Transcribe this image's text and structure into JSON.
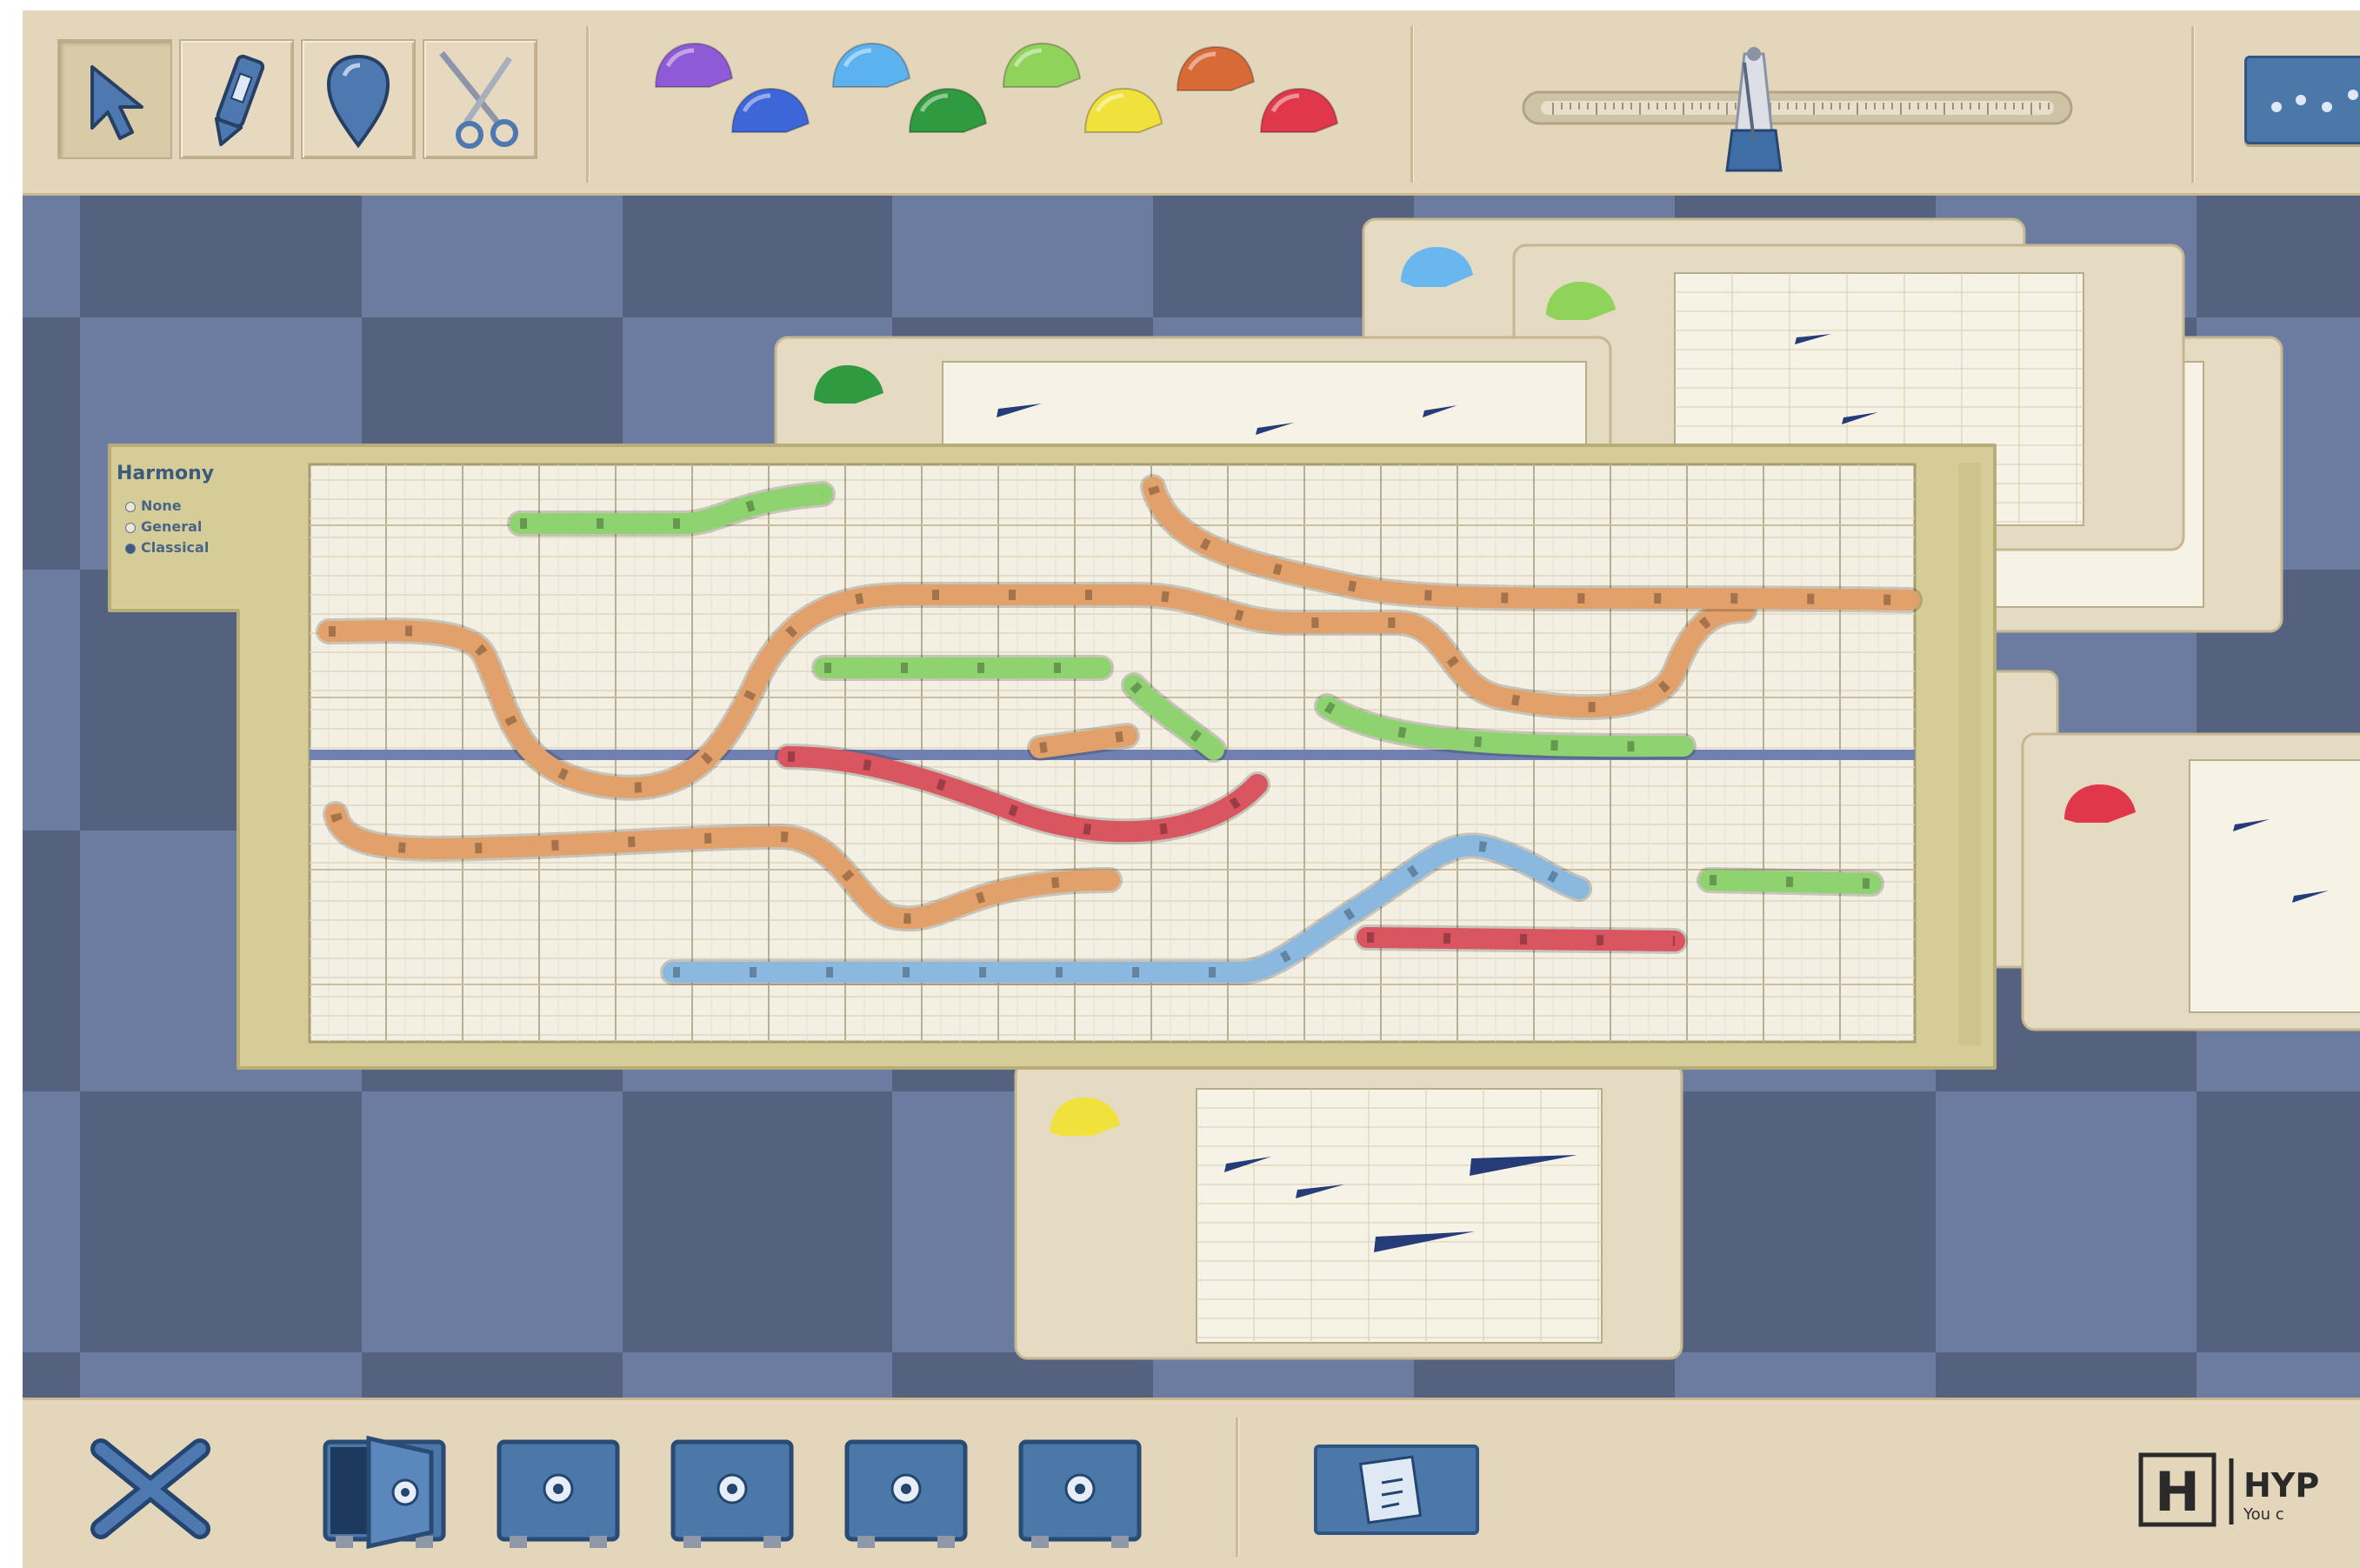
{
  "toolbar": {
    "tools": [
      {
        "name": "pointer",
        "icon": "arrow-cursor-icon",
        "active": true
      },
      {
        "name": "pencil",
        "icon": "pencil-icon",
        "active": false
      },
      {
        "name": "eraser",
        "icon": "eraser-drop-icon",
        "active": false
      },
      {
        "name": "scissors",
        "icon": "scissors-icon",
        "active": false
      }
    ],
    "instrument_colors": [
      "#8f5ad6",
      "#3d66d8",
      "#5cb2ee",
      "#2f9a3f",
      "#8fd35a",
      "#f0e23a",
      "#d86a38",
      "#e0384a"
    ],
    "tempo_icon": "metronome-icon",
    "tempo_level": 0.42
  },
  "harmony": {
    "title": "Harmony",
    "options": [
      {
        "label": "None",
        "selected": false
      },
      {
        "label": "General",
        "selected": false
      },
      {
        "label": "Classical",
        "selected": true
      }
    ]
  },
  "bottom": {
    "close_icon": "close-x-icon",
    "safes": [
      {
        "icon": "open-safe-icon",
        "open": true
      },
      {
        "icon": "safe-icon",
        "open": false
      },
      {
        "icon": "safe-icon",
        "open": false
      },
      {
        "icon": "safe-icon",
        "open": false
      },
      {
        "icon": "safe-icon",
        "open": false
      }
    ],
    "save_icon": "notes-document-icon",
    "logo_text": "HYP",
    "logo_subtext": "You c"
  },
  "colors": {
    "toolbar_bg": "#e3d6bb",
    "stage_dark": "#55627f",
    "stage_light": "#6b7ca0",
    "panel_frame": "#d6cc98",
    "track_orange": "#e2a06a",
    "track_green": "#8fd370",
    "track_red": "#d95560",
    "track_blue": "#8ab8de",
    "baseline": "#7080b0"
  }
}
